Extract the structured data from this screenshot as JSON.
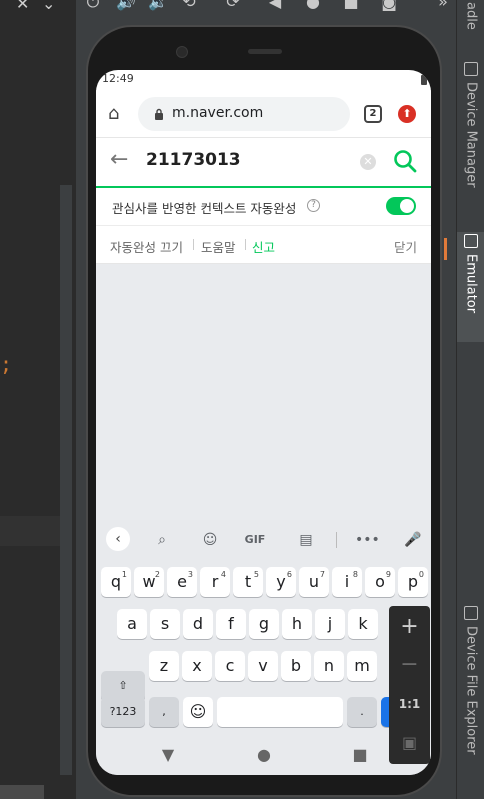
{
  "ide": {
    "code_fragment": ";",
    "toolbar_right_glyph": "»",
    "close_glyph": "✕",
    "chevron_glyph": "⌄"
  },
  "right_rail": {
    "tabs": [
      {
        "label": "adle"
      },
      {
        "label": "Device Manager"
      },
      {
        "label": "Emulator"
      },
      {
        "label": "Device File Explorer"
      }
    ]
  },
  "phone": {
    "status_time": "12:49",
    "browser": {
      "url": "m.naver.com",
      "tab_count": "2"
    },
    "search": {
      "query": "21173013"
    },
    "context_toggle": {
      "label": "관심사를 반영한 컨텍스트 자동완성",
      "enabled": true,
      "accent_color": "#03c75a"
    },
    "options": {
      "autocomplete_off": "자동완성 끄기",
      "help": "도움말",
      "report": "신고",
      "close": "닫기"
    },
    "keyboard": {
      "gif_label": "GIF",
      "row1": [
        {
          "k": "q",
          "n": "1"
        },
        {
          "k": "w",
          "n": "2"
        },
        {
          "k": "e",
          "n": "3"
        },
        {
          "k": "r",
          "n": "4"
        },
        {
          "k": "t",
          "n": "5"
        },
        {
          "k": "y",
          "n": "6"
        },
        {
          "k": "u",
          "n": "7"
        },
        {
          "k": "i",
          "n": "8"
        },
        {
          "k": "o",
          "n": "9"
        },
        {
          "k": "p",
          "n": "0"
        }
      ],
      "row2": [
        "a",
        "s",
        "d",
        "f",
        "g",
        "h",
        "j",
        "k"
      ],
      "row3": [
        "z",
        "x",
        "c",
        "v",
        "b",
        "n",
        "m"
      ],
      "symbols_label": "?123",
      "comma": ",",
      "period": "."
    }
  },
  "emulator_panel": {
    "zoom_in": "+",
    "zoom_out": "−",
    "ratio": "1:1"
  }
}
